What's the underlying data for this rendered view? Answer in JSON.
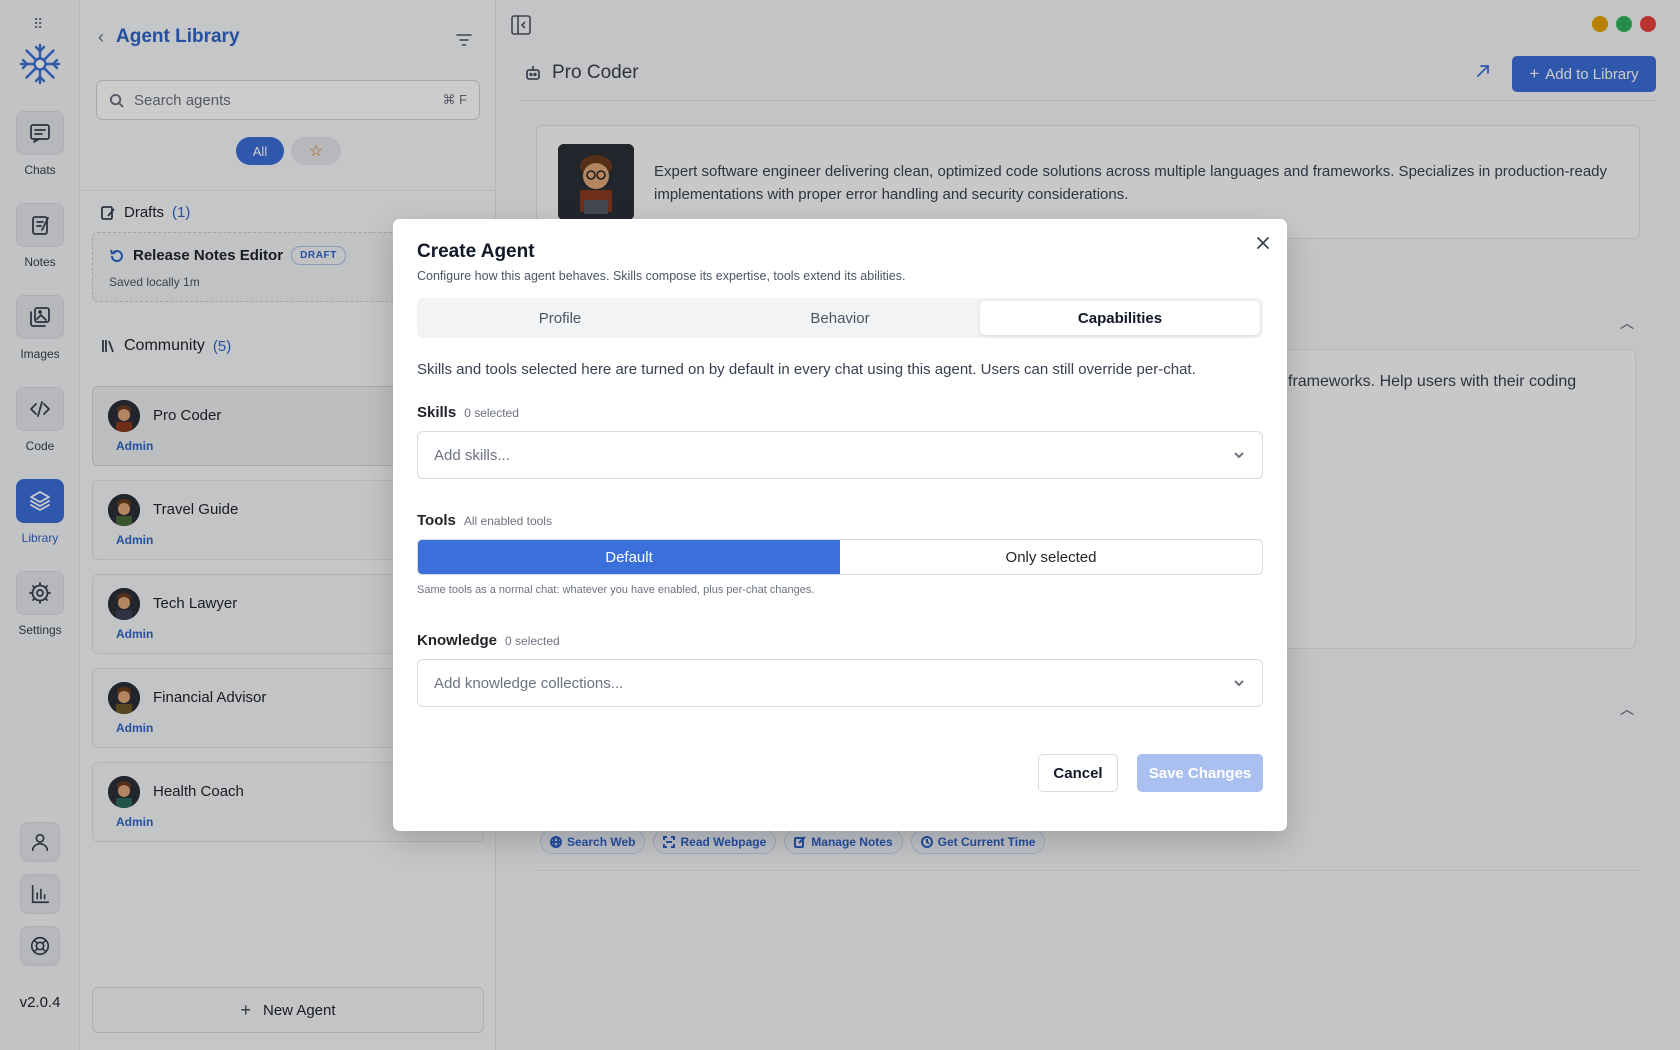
{
  "rail": {
    "nav": [
      {
        "label": "Chats",
        "icon": "chat-icon"
      },
      {
        "label": "Notes",
        "icon": "notes-icon"
      },
      {
        "label": "Images",
        "icon": "images-icon"
      },
      {
        "label": "Code",
        "icon": "code-icon"
      },
      {
        "label": "Library",
        "icon": "library-icon"
      },
      {
        "label": "Settings",
        "icon": "gear-icon"
      }
    ],
    "active": "Library",
    "version": "v2.0.4"
  },
  "library": {
    "title": "Agent Library",
    "search_placeholder": "Search agents",
    "search_shortcut": "⌘ F",
    "filter_all": "All",
    "drafts_label": "Drafts",
    "drafts_count": "(1)",
    "draft": {
      "name": "Release Notes Editor",
      "badge": "DRAFT",
      "meta": "Saved locally 1m"
    },
    "community_label": "Community",
    "community_count": "(5)",
    "agents": [
      {
        "name": "Pro Coder",
        "role": "Admin"
      },
      {
        "name": "Travel Guide",
        "role": "Admin"
      },
      {
        "name": "Tech Lawyer",
        "role": "Admin"
      },
      {
        "name": "Financial Advisor",
        "role": "Admin"
      },
      {
        "name": "Health Coach",
        "role": "Admin"
      }
    ],
    "new_agent": "New Agent"
  },
  "main": {
    "agent_name": "Pro Coder",
    "add_to_library": "Add to Library",
    "description": "Expert software engineer delivering clean, optimized code solutions across multiple languages and frameworks. Specializes in production-ready implementations with proper error handling and security considerations.",
    "prompt_excerpt": "frameworks. Help users with their coding",
    "tools": [
      "Search Web",
      "Read Webpage",
      "Manage Notes",
      "Get Current Time"
    ],
    "colors": {
      "accent": "#3b6fd9",
      "traffic_yellow": "#e0a100",
      "traffic_green": "#2fb35a",
      "traffic_red": "#e5413b"
    }
  },
  "modal": {
    "title": "Create Agent",
    "subtitle": "Configure how this agent behaves. Skills compose its expertise, tools extend its abilities.",
    "tabs": [
      "Profile",
      "Behavior",
      "Capabilities"
    ],
    "active_tab": "Capabilities",
    "intro": "Skills and tools selected here are turned on by default in every chat using this agent. Users can still override per-chat.",
    "skills_label": "Skills",
    "skills_meta": "0 selected",
    "skills_placeholder": "Add skills...",
    "tools_label": "Tools",
    "tools_meta": "All enabled tools",
    "tools_options": [
      "Default",
      "Only selected"
    ],
    "tools_selected": "Default",
    "tools_hint": "Same tools as a normal chat: whatever you have enabled, plus per-chat changes.",
    "knowledge_label": "Knowledge",
    "knowledge_meta": "0 selected",
    "knowledge_placeholder": "Add knowledge collections...",
    "cancel": "Cancel",
    "save": "Save Changes"
  }
}
